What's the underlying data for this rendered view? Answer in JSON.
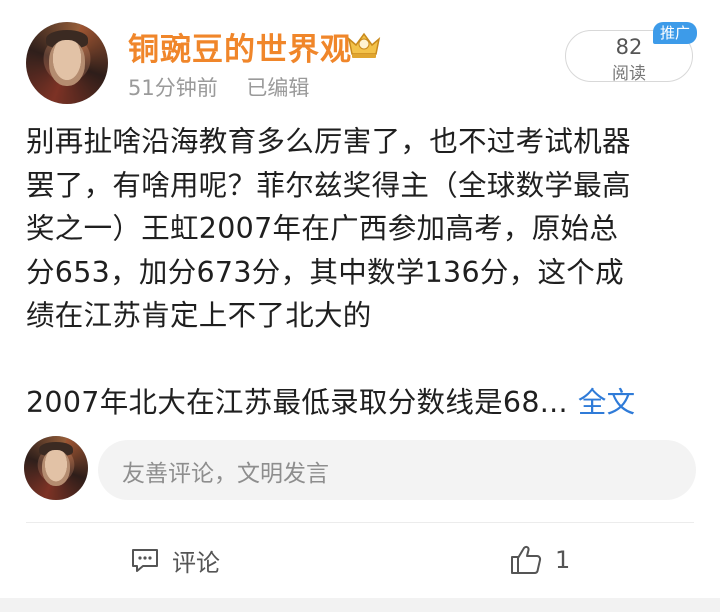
{
  "post": {
    "author": "铜豌豆的世界观",
    "time": "51分钟前",
    "edited": "已编辑",
    "read_count": "82",
    "read_label": "阅读",
    "badge": "推广",
    "lines": [
      "别再扯啥沿海教育多么厉害了，也不过考试机器",
      "罢了，有啥用呢？菲尔兹奖得主（全球数学最高",
      "奖之一）王虹2007年在广西参加高考，原始总",
      "分653，加分673分，其中数学136分，这个成",
      "绩在江苏肯定上不了北大的"
    ],
    "truncated_line": "2007年北大在江苏最低录取分数线是68...",
    "full_text_link": "全文"
  },
  "comment_input": {
    "placeholder": "友善评论，文明发言"
  },
  "actions": {
    "comment_label": "评论",
    "like_count": "1"
  },
  "icons": {
    "author_badge": "crown-icon",
    "comment": "comment-icon",
    "like": "thumbs-up-icon"
  },
  "colors": {
    "author": "#f0862a",
    "link": "#2f7bd8",
    "badge": "#3d9be9"
  }
}
